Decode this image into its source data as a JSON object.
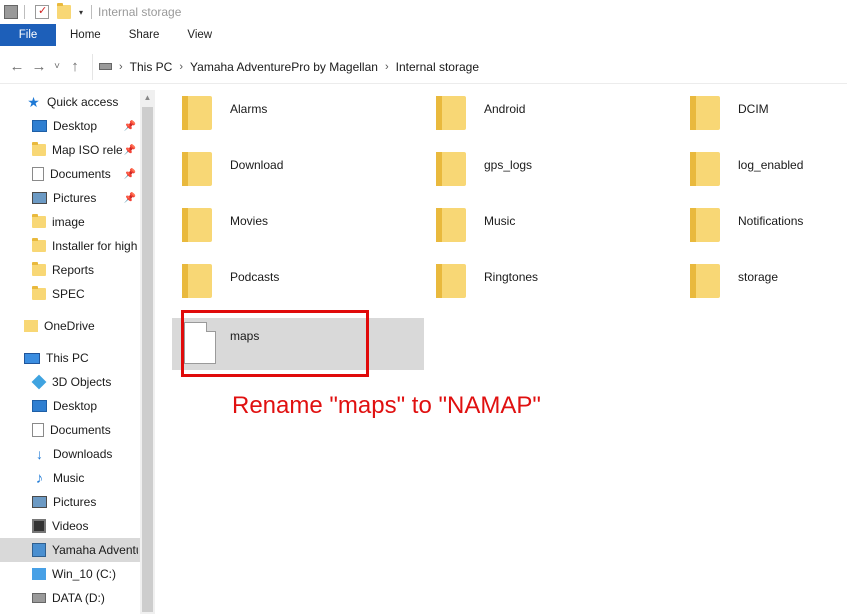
{
  "titlebar": {
    "title": "Internal storage"
  },
  "ribbon": {
    "tabs": [
      "File",
      "Home",
      "Share",
      "View"
    ]
  },
  "address": {
    "crumbs": [
      "This PC",
      "Yamaha AdventurePro by Magellan",
      "Internal storage"
    ]
  },
  "nav": {
    "quick_access": {
      "label": "Quick access"
    },
    "pinned": [
      {
        "label": "Desktop"
      },
      {
        "label": "Map ISO release"
      },
      {
        "label": "Documents"
      },
      {
        "label": "Pictures"
      }
    ],
    "recent": [
      {
        "label": "image"
      },
      {
        "label": "Installer for high"
      },
      {
        "label": "Reports"
      },
      {
        "label": "SPEC"
      }
    ],
    "onedrive": {
      "label": "OneDrive"
    },
    "this_pc": {
      "label": "This PC"
    },
    "pc_items": [
      {
        "label": "3D Objects"
      },
      {
        "label": "Desktop"
      },
      {
        "label": "Documents"
      },
      {
        "label": "Downloads"
      },
      {
        "label": "Music"
      },
      {
        "label": "Pictures"
      },
      {
        "label": "Videos"
      },
      {
        "label": "Yamaha AdventurePro"
      },
      {
        "label": "Win_10 (C:)"
      },
      {
        "label": "DATA (D:)"
      }
    ]
  },
  "folders": [
    [
      "Alarms",
      "Android",
      "DCIM"
    ],
    [
      "Download",
      "gps_logs",
      "log_enabled"
    ],
    [
      "Movies",
      "Music",
      "Notifications"
    ],
    [
      "Podcasts",
      "Ringtones",
      "storage"
    ]
  ],
  "file_item": {
    "label": "maps"
  },
  "annotation": {
    "text": "Rename \"maps\" to \"NAMAP\"",
    "color": "#e01010"
  }
}
